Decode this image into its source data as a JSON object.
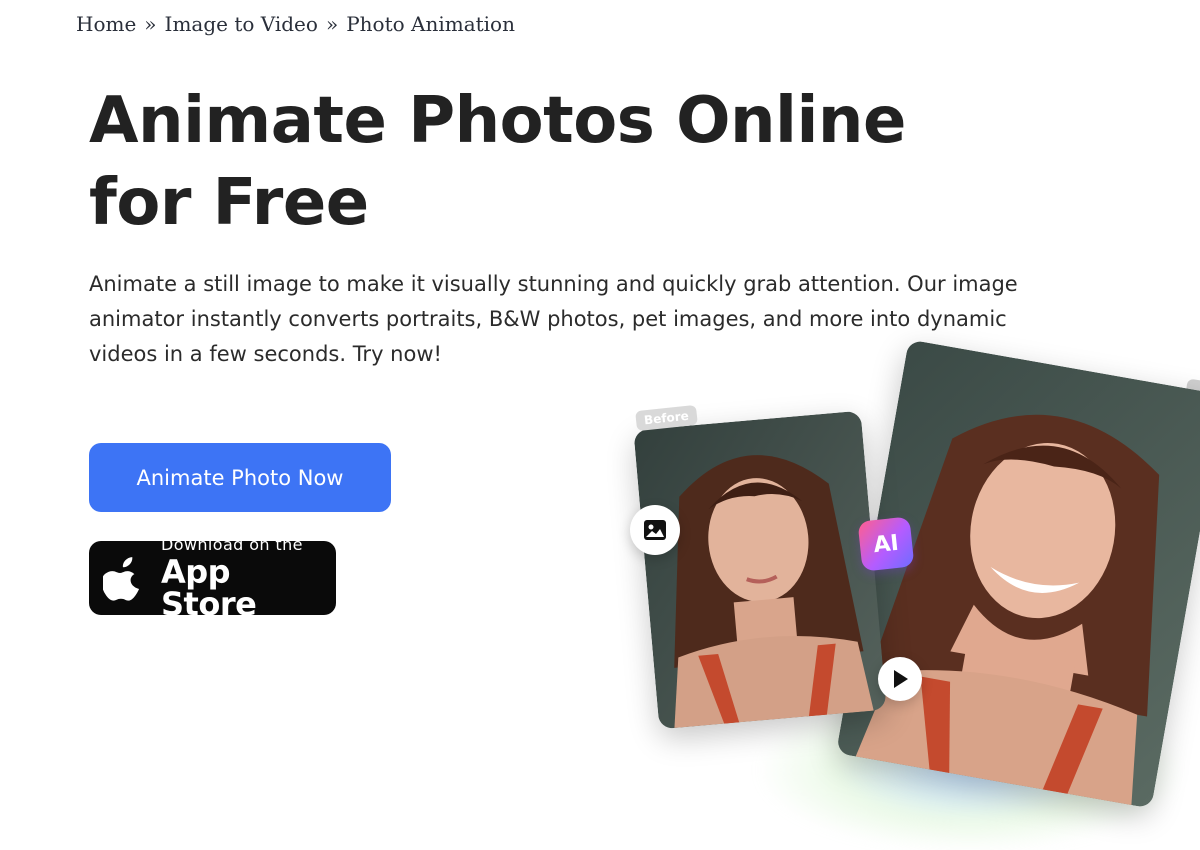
{
  "breadcrumb": {
    "items": [
      "Home",
      "Image to Video",
      "Photo Animation"
    ],
    "separator": "»"
  },
  "hero": {
    "title": "Animate Photos Online for Free",
    "description": "Animate a still image to make it visually stunning and quickly grab attention. Our image animator instantly converts portraits, B&W photos, pet images, and more into dynamic videos in a few seconds. Try now!",
    "cta_label": "Animate Photo Now",
    "appstore_small": "Download on the",
    "appstore_big": "App Store"
  },
  "illustration": {
    "before_tag": "Before",
    "ai_badge": "AI"
  },
  "colors": {
    "cta": "#3d74f5",
    "appstore": "#0a0a0a",
    "title": "#222222"
  },
  "icons": [
    "apple-icon",
    "image-icon",
    "play-icon"
  ]
}
